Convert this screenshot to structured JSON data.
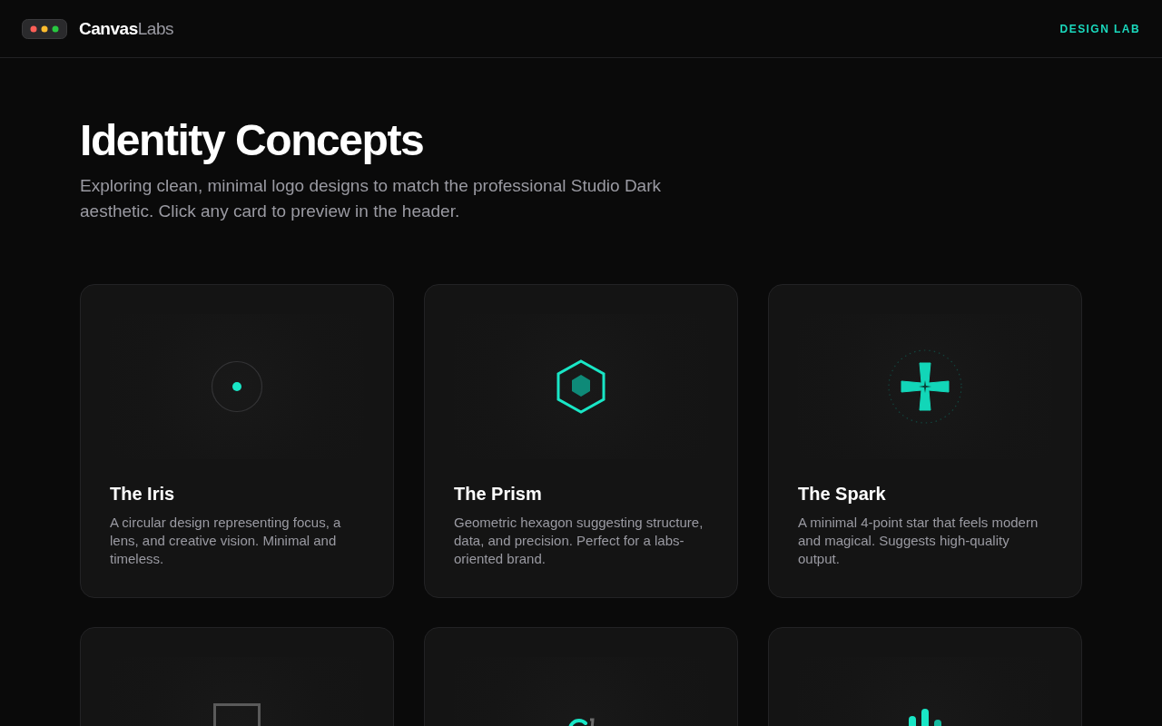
{
  "header": {
    "logo_text": "**Canvas**Labs",
    "nav_link": "DESIGN LAB"
  },
  "page": {
    "title": "Identity Concepts",
    "subtitle": "Exploring clean, minimal logo designs to match the professional Studio Dark aesthetic. Click any card to preview in the header."
  },
  "cards": [
    {
      "kind": "iris",
      "title": "The Iris",
      "description": "A circular design representing focus, a lens, and creative vision. Minimal and timeless."
    },
    {
      "kind": "prism",
      "title": "The Prism",
      "description": "Geometric hexagon suggesting structure, data, and precision. Perfect for a labs-oriented brand."
    },
    {
      "kind": "spark",
      "title": "The Spark",
      "description": "A minimal 4-point star that feels modern and magical. Suggests high-quality output."
    },
    {
      "kind": "frame"
    },
    {
      "kind": "arc"
    },
    {
      "kind": "bars"
    }
  ]
}
